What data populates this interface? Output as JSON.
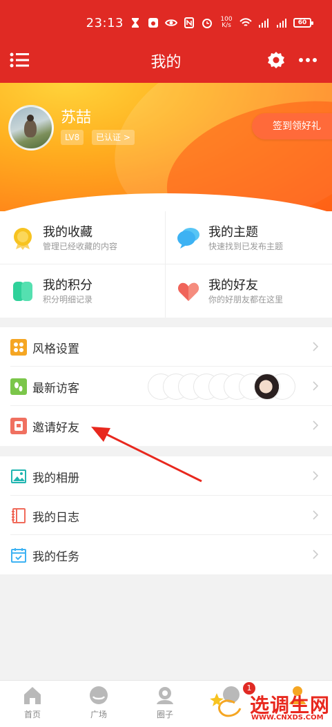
{
  "status_bar": {
    "time": "23:13",
    "speed": "100\nK/s",
    "battery": "60",
    "icons": [
      "hourglass-icon",
      "baidu-icon",
      "eye-icon",
      "nfc-icon",
      "alarm-icon",
      "wifi-icon",
      "4g-signal-icon",
      "5g-signal-icon"
    ]
  },
  "nav": {
    "title": "我的",
    "icons": [
      "menu-icon",
      "gear-icon",
      "more-icon"
    ]
  },
  "profile": {
    "name": "苏喆",
    "level": "LV8",
    "certified": "已认证 >",
    "signin_button": "签到领好礼"
  },
  "quick": [
    {
      "title": "我的收藏",
      "subtitle": "管理已经收藏的内容",
      "icon": "medal-icon",
      "color": "#f7c320"
    },
    {
      "title": "我的主题",
      "subtitle": "快速找到已发布主题",
      "icon": "chat-bubble-icon",
      "color": "#3db2f3"
    },
    {
      "title": "我的积分",
      "subtitle": "积分明细记录",
      "icon": "points-icon",
      "color": "#2fd19a"
    },
    {
      "title": "我的好友",
      "subtitle": "你的好朋友都在这里",
      "icon": "heart-icon",
      "color": "#f0645a"
    }
  ],
  "group1": [
    {
      "label": "风格设置",
      "icon": "style-icon",
      "color": "#f5a623"
    },
    {
      "label": "最新访客",
      "icon": "footprint-icon",
      "color": "#7bc64a"
    },
    {
      "label": "邀请好友",
      "icon": "invite-icon",
      "color": "#f07060"
    }
  ],
  "group2": [
    {
      "label": "我的相册",
      "icon": "album-icon",
      "color": "#1fb5b0"
    },
    {
      "label": "我的日志",
      "icon": "journal-icon",
      "color": "#f06a5a"
    },
    {
      "label": "我的任务",
      "icon": "task-icon",
      "color": "#3db2f3"
    }
  ],
  "bottom_nav": [
    {
      "label": "首页",
      "icon": "home-icon"
    },
    {
      "label": "广场",
      "icon": "plaza-icon"
    },
    {
      "label": "圈子",
      "icon": "circle-icon"
    },
    {
      "label": "",
      "icon": "message-icon",
      "badge": "1"
    },
    {
      "label": "",
      "icon": "me-icon"
    }
  ],
  "watermark": {
    "text": "选调生网",
    "url": "WWW.CNXDS.COM"
  }
}
